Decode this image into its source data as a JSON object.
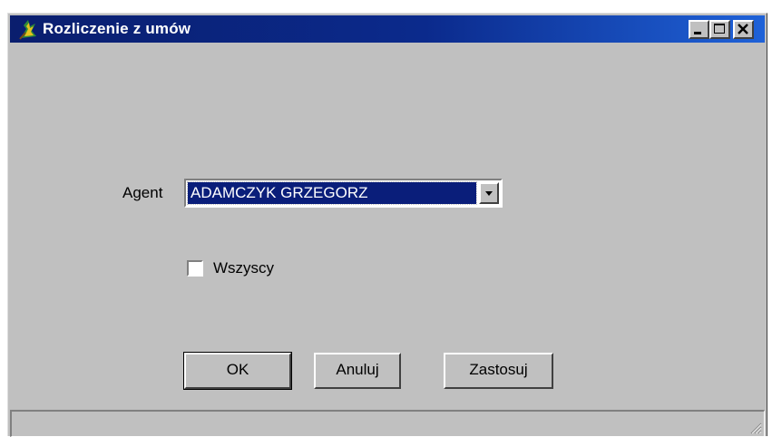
{
  "window": {
    "title": "Rozliczenie z umów",
    "icon": "app-icon",
    "controls": [
      "minimize-icon",
      "maximize-icon",
      "close-icon"
    ]
  },
  "form": {
    "agent_label": "Agent",
    "agent_value": "ADAMCZYK GRZEGORZ",
    "all_label": "Wszyscy",
    "all_checked": false
  },
  "buttons": {
    "ok": "OK",
    "cancel": "Anuluj",
    "apply": "Zastosuj"
  },
  "colors": {
    "titlebar_start": "#0a1e6e",
    "titlebar_end": "#1f62d8",
    "face": "#c0c0c0",
    "selection": "#0a1e7a"
  }
}
